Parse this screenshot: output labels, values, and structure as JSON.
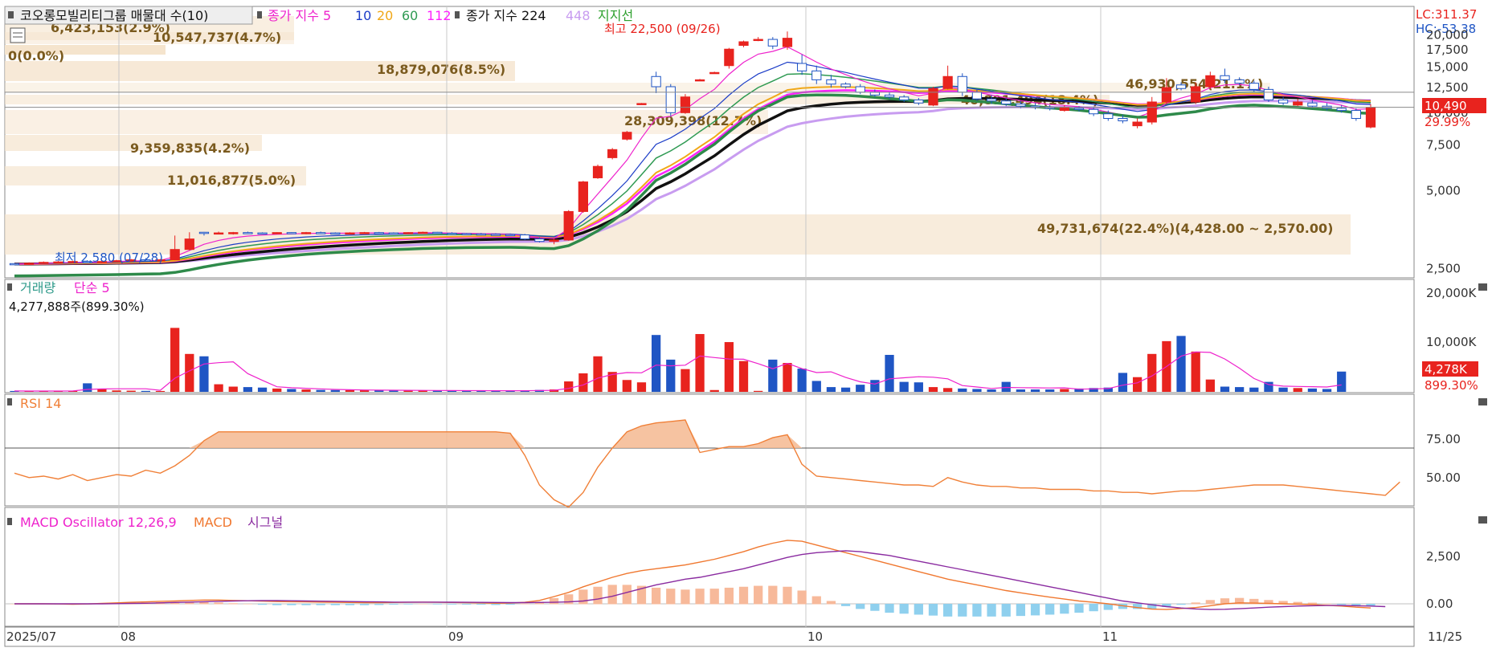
{
  "colors": {
    "up": "#e8231e",
    "down": "#1f55c4",
    "ma5": "#ee22cc",
    "ma10": "#1b3cc7",
    "ma20": "#f0a818",
    "ma60": "#2e9a52",
    "ma112": "#ff22ff",
    "ma224": "#111111",
    "ma448": "#c89cf0",
    "volume_profile": "#f5e4cd",
    "rsi": "#f08038",
    "macd": "#f07830",
    "signal": "#8a2ba0",
    "osc_pos": "#f7b99a",
    "osc_neg": "#8fd0ee"
  },
  "price_panel": {
    "title": "코오롱모빌리티그룹 매물대 수(10)",
    "legend_ma": "종가 지수 5",
    "legend_10": "10",
    "legend_20": "20",
    "legend_60": "60",
    "legend_112": "112",
    "legend_ma2": "종가 지수 224",
    "legend_448": "448",
    "legend_support": "지지선",
    "lc": "LC:311.37",
    "hc": "HC:-53.38",
    "last_price_tag": "10,490",
    "last_change_tag": "29.99%",
    "high_label": "최고 22,500 (09/26)",
    "low_label": "최저 2,580 (07/28)",
    "y_ticks": [
      "20,000",
      "17,500",
      "15,000",
      "12,500",
      "10,000",
      "7,500",
      "5,000",
      "2,500"
    ]
  },
  "volume_profile_labels": [
    "6,423,153(2.9%)",
    "10,547,737(4.7%)",
    "0(0.0%)",
    "18,879,076(8.5%)",
    "46,930,554(21.1%)",
    "40,891,494(18.4%)",
    "28,309,398(12.7%)",
    "9,359,835(4.2%)",
    "11,016,877(5.0%)",
    "49,731,674(22.4%)(4,428.00 ~ 2,570.00)"
  ],
  "volume_panel": {
    "title": "거래량",
    "ma_title": "단순 5",
    "value_text": "4,277,888주(899.30%)",
    "y_ticks": [
      "20,000K",
      "10,000K"
    ],
    "last_tag": "4,278K",
    "last_pct": "899.30%"
  },
  "rsi_panel": {
    "title": "RSI 14",
    "y_ticks": [
      "75.00",
      "50.00"
    ]
  },
  "macd_panel": {
    "title": "MACD Oscillator 12,26,9",
    "macd_label": "MACD",
    "signal_label": "시그널",
    "y_ticks": [
      "2,500",
      "0.00"
    ]
  },
  "x_axis": {
    "labels": [
      "2025/07",
      "08",
      "09",
      "10",
      "11",
      "11/25"
    ]
  },
  "chart_data": {
    "type": "candlestick",
    "title": "코오롱모빌리티그룹",
    "price_scale": "log",
    "price_ylim": [
      2300,
      22000
    ],
    "candles": [
      [
        2610,
        2620,
        2580,
        2600
      ],
      [
        2600,
        2640,
        2585,
        2620
      ],
      [
        2620,
        2660,
        2600,
        2640
      ],
      [
        2640,
        2670,
        2610,
        2650
      ],
      [
        2650,
        2680,
        2620,
        2660
      ],
      [
        2660,
        2690,
        2630,
        2650
      ],
      [
        2650,
        2680,
        2620,
        2660
      ],
      [
        2660,
        2700,
        2640,
        2680
      ],
      [
        2680,
        2720,
        2650,
        2700
      ],
      [
        2700,
        2740,
        2660,
        2690
      ],
      [
        2690,
        2720,
        2650,
        2700
      ],
      [
        2700,
        3350,
        2700,
        2960
      ],
      [
        2960,
        3450,
        2940,
        3250
      ],
      [
        3450,
        3460,
        3350,
        3430
      ],
      [
        3430,
        3470,
        3390,
        3430
      ],
      [
        3430,
        3460,
        3380,
        3440
      ],
      [
        3440,
        3470,
        3400,
        3430
      ],
      [
        3430,
        3450,
        3390,
        3420
      ],
      [
        3420,
        3450,
        3390,
        3440
      ],
      [
        3440,
        3450,
        3400,
        3420
      ],
      [
        3420,
        3460,
        3390,
        3440
      ],
      [
        3440,
        3470,
        3410,
        3430
      ],
      [
        3430,
        3450,
        3400,
        3420
      ],
      [
        3420,
        3450,
        3400,
        3430
      ],
      [
        3430,
        3460,
        3410,
        3440
      ],
      [
        3440,
        3460,
        3410,
        3430
      ],
      [
        3430,
        3450,
        3400,
        3420
      ],
      [
        3420,
        3450,
        3400,
        3440
      ],
      [
        3440,
        3470,
        3420,
        3450
      ],
      [
        3450,
        3460,
        3410,
        3420
      ],
      [
        3420,
        3450,
        3390,
        3410
      ],
      [
        3410,
        3430,
        3380,
        3400
      ],
      [
        3400,
        3430,
        3370,
        3390
      ],
      [
        3390,
        3420,
        3360,
        3380
      ],
      [
        3380,
        3410,
        3350,
        3370
      ],
      [
        3370,
        3400,
        3220,
        3250
      ],
      [
        3250,
        3300,
        3150,
        3180
      ],
      [
        3180,
        3260,
        3100,
        3220
      ],
      [
        3220,
        4200,
        3200,
        4150
      ],
      [
        4150,
        5450,
        4100,
        5400
      ],
      [
        5600,
        6300,
        5550,
        6200
      ],
      [
        6700,
        7300,
        6600,
        7200
      ],
      [
        7900,
        8500,
        7800,
        8400
      ],
      [
        10800,
        10900,
        10750,
        10850
      ],
      [
        13800,
        14400,
        11900,
        12600
      ],
      [
        12600,
        12900,
        9700,
        10000
      ],
      [
        10000,
        11800,
        9900,
        11500
      ],
      [
        13400,
        13500,
        13300,
        13400
      ],
      [
        14300,
        14400,
        14200,
        14300
      ],
      [
        15200,
        17800,
        14800,
        17600
      ],
      [
        18200,
        19000,
        17900,
        18800
      ],
      [
        19000,
        19600,
        18900,
        19200
      ],
      [
        19200,
        19600,
        17600,
        18100
      ],
      [
        18000,
        20600,
        17500,
        19400
      ],
      [
        15500,
        16800,
        14000,
        14500
      ],
      [
        14500,
        15200,
        12900,
        13400
      ],
      [
        13400,
        14000,
        12500,
        12900
      ],
      [
        12900,
        13100,
        12400,
        12600
      ],
      [
        12600,
        12900,
        11800,
        12000
      ],
      [
        12000,
        12300,
        11500,
        11700
      ],
      [
        11700,
        12000,
        11300,
        11500
      ],
      [
        11500,
        11700,
        11000,
        11200
      ],
      [
        11200,
        11400,
        10700,
        10900
      ],
      [
        10700,
        12600,
        10600,
        12400
      ],
      [
        12400,
        15200,
        12300,
        13800
      ],
      [
        13800,
        14200,
        11600,
        12000
      ],
      [
        12000,
        12400,
        11100,
        11300
      ],
      [
        11300,
        11700,
        10800,
        11100
      ],
      [
        11100,
        11400,
        10600,
        10800
      ],
      [
        10800,
        11100,
        10400,
        10600
      ],
      [
        10600,
        10900,
        10300,
        10500
      ],
      [
        10500,
        10700,
        10200,
        10400
      ],
      [
        10200,
        10700,
        10100,
        10500
      ],
      [
        10400,
        10600,
        10100,
        10300
      ],
      [
        10300,
        10500,
        9700,
        9900
      ],
      [
        9900,
        10200,
        9300,
        9500
      ],
      [
        9500,
        9800,
        9100,
        9300
      ],
      [
        8900,
        9500,
        8700,
        9200
      ],
      [
        9200,
        11500,
        9000,
        11000
      ],
      [
        11000,
        13600,
        10800,
        12500
      ],
      [
        12800,
        13100,
        12200,
        12400
      ],
      [
        11000,
        13100,
        10800,
        12600
      ],
      [
        12600,
        14400,
        12400,
        13900
      ],
      [
        13900,
        14800,
        13000,
        13400
      ],
      [
        13400,
        13700,
        12800,
        13000
      ],
      [
        13000,
        13300,
        12000,
        12300
      ],
      [
        12300,
        12600,
        11000,
        11200
      ],
      [
        11200,
        11500,
        10700,
        10900
      ],
      [
        10700,
        11300,
        10600,
        11000
      ],
      [
        10900,
        11200,
        10400,
        10600
      ],
      [
        10600,
        10900,
        10200,
        10400
      ],
      [
        10400,
        10700,
        10000,
        10200
      ],
      [
        10200,
        10400,
        9300,
        9500
      ],
      [
        8800,
        10800,
        8700,
        10490
      ]
    ],
    "volume": [
      180,
      170,
      160,
      200,
      240,
      1800,
      650,
      300,
      250,
      200,
      180,
      13500,
      8000,
      7500,
      1600,
      1100,
      1000,
      900,
      700,
      600,
      500,
      400,
      380,
      350,
      330,
      320,
      300,
      280,
      270,
      260,
      250,
      240,
      230,
      220,
      210,
      300,
      400,
      500,
      2200,
      3900,
      7500,
      4200,
      2500,
      2000,
      12000,
      6800,
      4800,
      12200,
      380,
      10500,
      6500,
      200,
      6800,
      6100,
      4900,
      2300,
      1000,
      900,
      1500,
      2500,
      7800,
      2100,
      2000,
      1000,
      800,
      700,
      600,
      500,
      2100,
      500,
      500,
      500,
      600,
      700,
      800,
      900,
      4000,
      3100,
      8000,
      10700,
      11800,
      8500,
      2600,
      1100,
      1000,
      900,
      2100,
      900,
      800,
      700,
      600,
      4278
    ],
    "rsi": [
      58,
      55,
      56,
      54,
      57,
      53,
      55,
      57,
      56,
      60,
      58,
      63,
      70,
      80,
      86,
      86,
      86,
      86,
      86,
      86,
      86,
      86,
      86,
      86,
      86,
      86,
      86,
      86,
      86,
      86,
      86,
      86,
      86,
      86,
      85,
      70,
      50,
      40,
      35,
      45,
      62,
      75,
      86,
      90,
      92,
      93,
      94,
      72,
      74,
      76,
      76,
      78,
      82,
      84,
      64,
      56,
      55,
      54,
      53,
      52,
      51,
      50,
      50,
      49,
      55,
      52,
      50,
      49,
      49,
      48,
      48,
      47,
      47,
      47,
      46,
      46,
      45,
      45,
      44,
      45,
      46,
      46,
      47,
      48,
      49,
      50,
      50,
      50,
      49,
      48,
      47,
      46,
      45,
      44,
      43,
      52
    ],
    "macd": [
      0,
      0,
      0,
      -10,
      -20,
      -10,
      20,
      50,
      80,
      100,
      130,
      150,
      180,
      200,
      200,
      180,
      160,
      140,
      120,
      110,
      100,
      90,
      80,
      70,
      60,
      60,
      70,
      80,
      90,
      80,
      70,
      60,
      50,
      30,
      40,
      80,
      180,
      380,
      600,
      900,
      1150,
      1400,
      1600,
      1750,
      1850,
      1950,
      2050,
      2200,
      2350,
      2550,
      2750,
      3000,
      3200,
      3350,
      3300,
      3100,
      2900,
      2700,
      2500,
      2300,
      2100,
      1900,
      1700,
      1500,
      1300,
      1150,
      1000,
      850,
      700,
      580,
      460,
      350,
      250,
      150,
      80,
      0,
      -100,
      -200,
      -280,
      -300,
      -250,
      -200,
      -100,
      0,
      50,
      40,
      20,
      0,
      -20,
      -40,
      -80,
      -120,
      -180,
      -220
    ],
    "signal": [
      0,
      0,
      0,
      0,
      0,
      0,
      0,
      10,
      20,
      30,
      50,
      70,
      90,
      110,
      130,
      150,
      160,
      170,
      170,
      160,
      150,
      140,
      130,
      120,
      110,
      100,
      90,
      90,
      90,
      90,
      85,
      80,
      75,
      70,
      65,
      65,
      70,
      80,
      100,
      150,
      250,
      400,
      600,
      800,
      1000,
      1150,
      1300,
      1400,
      1550,
      1700,
      1850,
      2050,
      2250,
      2450,
      2600,
      2700,
      2750,
      2800,
      2750,
      2650,
      2550,
      2400,
      2250,
      2100,
      1950,
      1800,
      1650,
      1500,
      1350,
      1200,
      1050,
      900,
      750,
      600,
      450,
      300,
      150,
      50,
      -50,
      -150,
      -220,
      -270,
      -300,
      -290,
      -260,
      -220,
      -180,
      -150,
      -120,
      -100,
      -90,
      -90,
      -100,
      -120,
      -150
    ]
  }
}
